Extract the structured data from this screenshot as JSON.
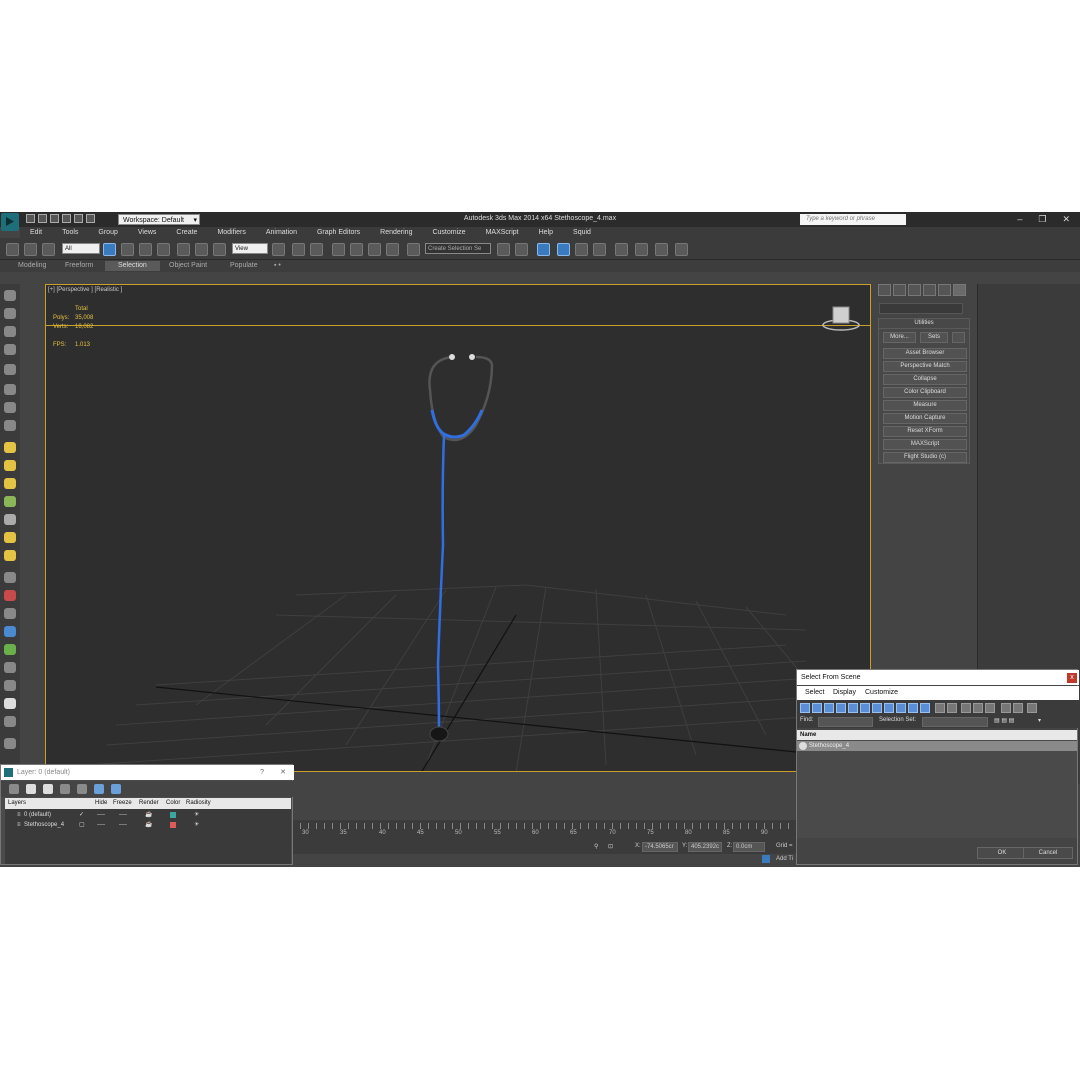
{
  "window": {
    "title": "Autodesk 3ds Max  2014 x64     Stethoscope_4.max",
    "workspace": "Workspace: Default",
    "search_placeholder": "Type a keyword or phrase",
    "controls": [
      "–",
      "❐",
      "✕"
    ]
  },
  "menu": [
    "Edit",
    "Tools",
    "Group",
    "Views",
    "Create",
    "Modifiers",
    "Animation",
    "Graph Editors",
    "Rendering",
    "Customize",
    "MAXScript",
    "Help",
    "Squid"
  ],
  "toolbar": {
    "filter_value": "All",
    "view_value": "View",
    "selection_set_placeholder": "Create Selection Se"
  },
  "ribbon": {
    "tabs": [
      "Modeling",
      "Freeform",
      "Selection",
      "Object Paint",
      "Populate"
    ],
    "active": "Selection",
    "extra": "▪ •"
  },
  "viewport": {
    "label": "[+] [Perspective ] [Realistic ]",
    "stats": {
      "header": "Total",
      "polys_label": "Polys:",
      "polys": "35,008",
      "verts_label": "Verts:",
      "verts": "18,082",
      "fps_label": "FPS:",
      "fps": "1.013"
    }
  },
  "command_panel": {
    "section": "Utilities",
    "more": "More...",
    "sets": "Sets",
    "buttons": [
      "Asset Browser",
      "Perspective Match",
      "Collapse",
      "Color Clipboard",
      "Measure",
      "Motion Capture",
      "Reset XForm",
      "MAXScript",
      "Flight Studio (c)"
    ]
  },
  "timeline": {
    "ticks": [
      "30",
      "35",
      "40",
      "45",
      "50",
      "55",
      "60",
      "65",
      "70",
      "75",
      "80",
      "85",
      "90"
    ]
  },
  "status": {
    "x_label": "X:",
    "x": "-74.5065cr",
    "y_label": "Y:",
    "y": "405.2392c",
    "z_label": "Z:",
    "z": "0.0cm",
    "grid": "Grid =",
    "addtime": "Add Ti"
  },
  "layer_dialog": {
    "title": "Layer: 0 (default)",
    "help": "?",
    "close": "✕",
    "columns": [
      "Layers",
      "Hide",
      "Freeze",
      "Render",
      "Color",
      "Radiosity"
    ],
    "rows": [
      {
        "name": "0 (default)",
        "active_mark": "✓",
        "hide": "----",
        "freeze": "----",
        "color": "#3aa7a0"
      },
      {
        "name": "Stethoscope_4",
        "active_mark": "▢",
        "hide": "----",
        "freeze": "----",
        "color": "#e05a5a"
      }
    ]
  },
  "select_from_scene": {
    "title": "Select From Scene",
    "close": "x",
    "menus": [
      "Select",
      "Display",
      "Customize"
    ],
    "find_label": "Find:",
    "selection_set_label": "Selection Set:",
    "column": "Name",
    "items": [
      "Stethoscope_4"
    ],
    "ok": "OK",
    "cancel": "Cancel"
  },
  "colors": {
    "viewport_border": "#c8a02a",
    "stats_text": "#e3c244",
    "tube": "#2f6fe0"
  }
}
